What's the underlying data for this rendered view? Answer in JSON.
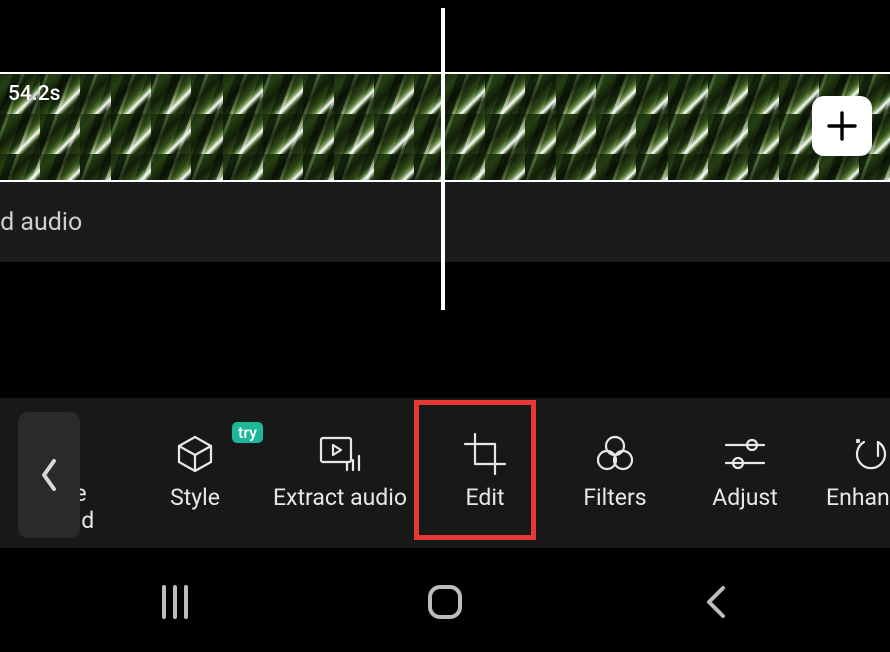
{
  "timeline": {
    "duration_label": "54.2s",
    "add_audio_label": "dd audio"
  },
  "toolbar": {
    "items": [
      {
        "label": "ve und"
      },
      {
        "label": "Style",
        "badge": "try"
      },
      {
        "label": "Extract audio"
      },
      {
        "label": "Edit"
      },
      {
        "label": "Filters"
      },
      {
        "label": "Adjust"
      },
      {
        "label": "Enhance"
      }
    ],
    "highlighted_index": 3
  }
}
